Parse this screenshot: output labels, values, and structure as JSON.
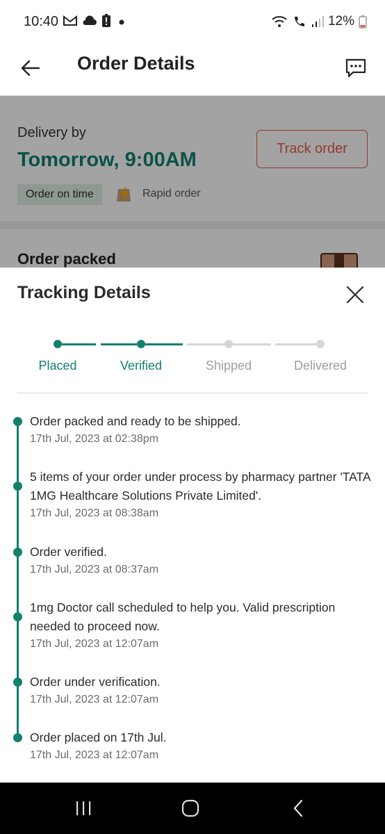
{
  "status_bar": {
    "time": "10:40",
    "battery": "12%",
    "icons": [
      "gmail-icon",
      "cloud-icon",
      "battery-alert-icon",
      "dot-icon",
      "wifi-icon",
      "wifi-calling-icon",
      "signal-icon",
      "battery-icon"
    ]
  },
  "header": {
    "title": "Order Details",
    "back_icon": "arrow-left-icon",
    "chat_icon": "chat-icon"
  },
  "delivery": {
    "label": "Delivery by",
    "time": "Tomorrow, 9:00AM",
    "track_button": "Track order",
    "on_time_badge": "Order on time",
    "rapid_label": "Rapid order",
    "order_status_title": "Order packed"
  },
  "tracking": {
    "title": "Tracking Details",
    "steps": [
      {
        "label": "Placed",
        "done": true
      },
      {
        "label": "Verified",
        "done": true
      },
      {
        "label": "Shipped",
        "done": false
      },
      {
        "label": "Delivered",
        "done": false
      }
    ],
    "events": [
      {
        "text": "Order packed and ready to be shipped.",
        "time": "17th Jul, 2023 at 02:38pm"
      },
      {
        "text": "5 items of your order under process by pharmacy partner 'TATA 1MG Healthcare Solutions Private Limited'.",
        "time": "17th Jul, 2023 at 08:38am"
      },
      {
        "text": "Order verified.",
        "time": "17th Jul, 2023 at 08:37am"
      },
      {
        "text": "1mg Doctor call scheduled to help you. Valid prescription needed to proceed now.",
        "time": "17th Jul, 2023 at 12:07am"
      },
      {
        "text": "Order under verification.",
        "time": "17th Jul, 2023 at 12:07am"
      },
      {
        "text": "Order placed on 17th Jul.",
        "time": "17th Jul, 2023 at 12:07am"
      }
    ]
  },
  "colors": {
    "accent": "#12806f",
    "track_button": "#e35b47",
    "inactive": "#d6d6d6",
    "inactive_text": "#9e9e9e"
  },
  "nav": {
    "icons": [
      "recent-apps-icon",
      "home-icon",
      "back-icon"
    ]
  }
}
